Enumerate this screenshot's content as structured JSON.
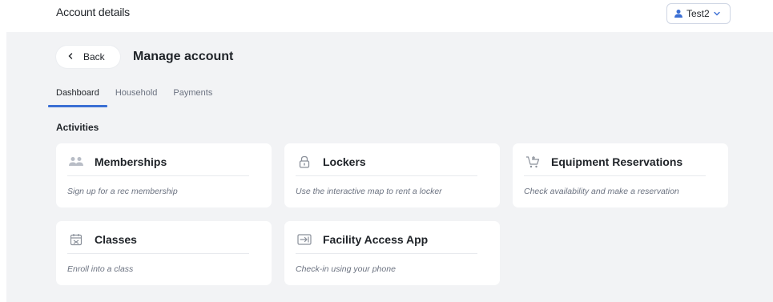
{
  "header": {
    "title": "Account details",
    "user_name": "Test2"
  },
  "nav": {
    "back_label": "Back",
    "page_title": "Manage account"
  },
  "tabs": [
    {
      "label": "Dashboard",
      "active": true
    },
    {
      "label": "Household",
      "active": false
    },
    {
      "label": "Payments",
      "active": false
    }
  ],
  "activities": {
    "section_title": "Activities",
    "cards": [
      {
        "icon": "people-icon",
        "title": "Memberships",
        "description": "Sign up for a rec membership"
      },
      {
        "icon": "lock-icon",
        "title": "Lockers",
        "description": "Use the interactive map to rent a locker"
      },
      {
        "icon": "cart-icon",
        "title": "Equipment Reservations",
        "description": "Check availability and make a reservation"
      },
      {
        "icon": "calendar-icon",
        "title": "Classes",
        "description": "Enroll into a class"
      },
      {
        "icon": "login-icon",
        "title": "Facility Access App",
        "description": "Check-in using your phone"
      }
    ]
  },
  "colors": {
    "accent": "#3b6fd4",
    "background": "#f2f3f5",
    "card": "#ffffff"
  }
}
